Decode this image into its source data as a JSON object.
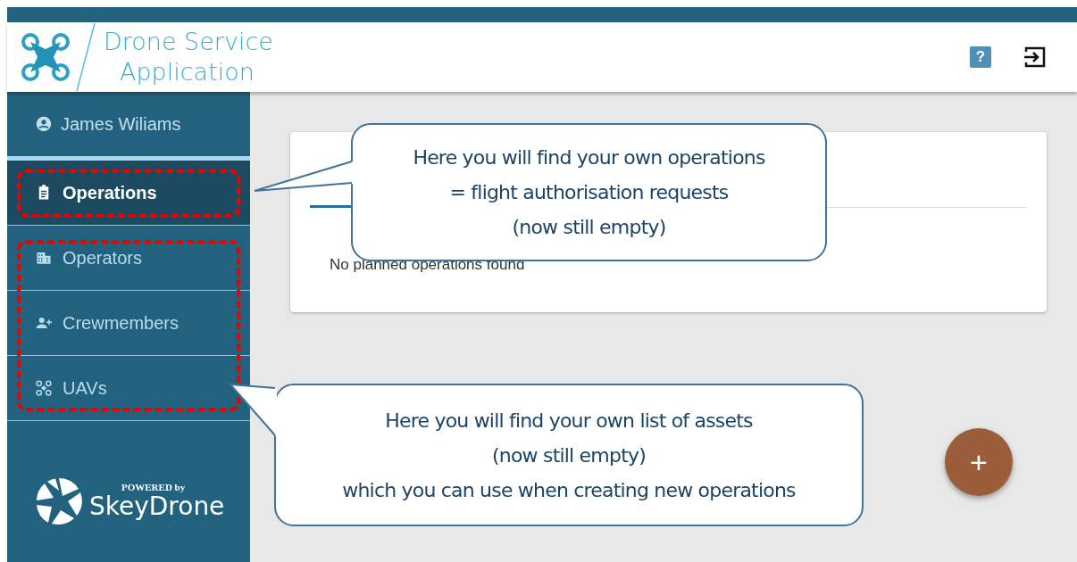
{
  "header": {
    "title_line_1": "Drone Service",
    "title_line_2": "Application",
    "help": "?"
  },
  "sidebar": {
    "user": "James Wiliams",
    "items": [
      {
        "label": "Operations",
        "kind": "clipboard",
        "selected": true
      },
      {
        "label": "Operators",
        "kind": "building",
        "selected": false
      },
      {
        "label": "Crewmembers",
        "kind": "person-add",
        "selected": false
      },
      {
        "label": "UAVs",
        "kind": "drone",
        "selected": false
      }
    ],
    "footer": {
      "powered_by": "POWERED by",
      "brand": "SkeyDrone"
    }
  },
  "card": {
    "message": "No planned operations found"
  },
  "fab": {
    "label": "+"
  },
  "callouts": [
    {
      "lines": [
        "Here you will find your own operations",
        "= flight authorisation requests",
        "(now still empty)"
      ]
    },
    {
      "lines": [
        "Here you will find your own list of assets",
        "(now still empty)",
        "which you can use when creating new operations"
      ]
    }
  ]
}
